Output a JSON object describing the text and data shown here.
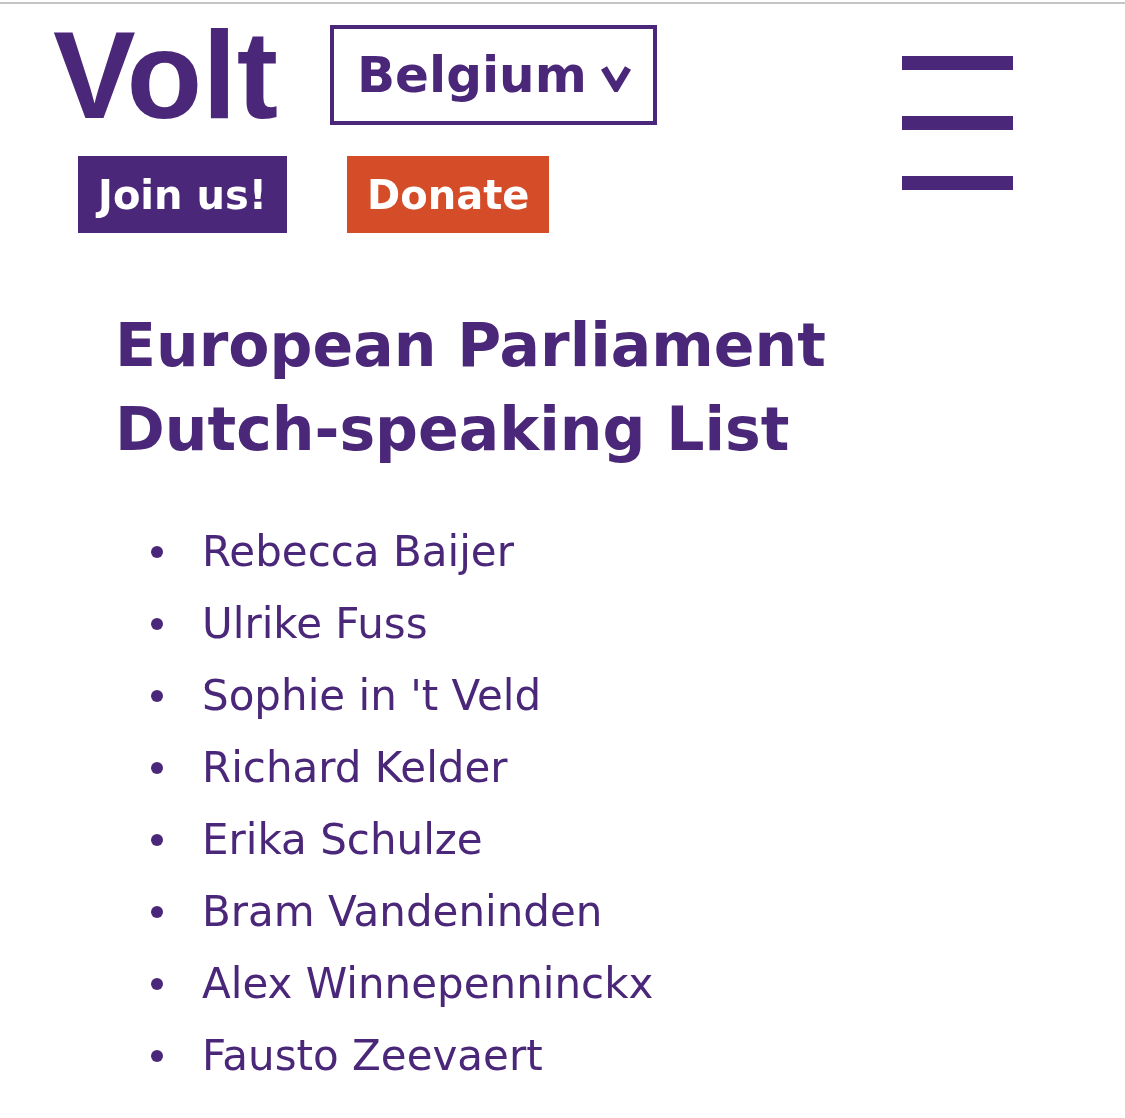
{
  "header": {
    "logo": "Volt",
    "country_selector": {
      "label": "Belgium"
    },
    "buttons": [
      {
        "label": "Join us!",
        "kind": "join"
      },
      {
        "label": "Donate",
        "kind": "donate"
      }
    ]
  },
  "heading": "European Parliament Dutch-speaking List",
  "candidates": [
    "Rebecca Baijer",
    "Ulrike Fuss",
    "Sophie in 't Veld",
    "Richard Kelder",
    "Erika Schulze",
    "Bram Vandeninden",
    "Alex Winnepenninckx",
    "Fausto Zeevaert"
  ]
}
